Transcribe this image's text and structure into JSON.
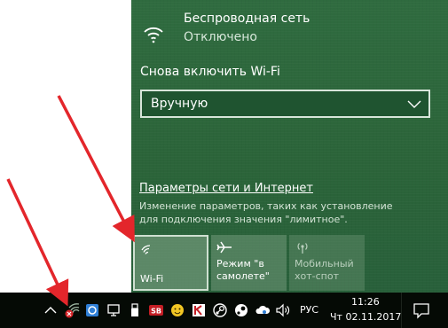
{
  "network": {
    "name": "Беспроводная сеть",
    "status": "Отключено",
    "icon": "wifi-disabled-icon"
  },
  "reenable": {
    "label": "Снова включить Wi-Fi",
    "selected": "Вручную"
  },
  "settings": {
    "link": "Параметры сети и Интернет",
    "description": "Изменение параметров, таких как установление для подключения значения \"лимитное\"."
  },
  "tiles": {
    "wifi": {
      "label": "Wi-Fi",
      "icon": "wifi-icon"
    },
    "airplane": {
      "label_line1": "Режим \"в",
      "label_line2": "самолете\"",
      "icon": "airplane-icon"
    },
    "hotspot": {
      "label_line1": "Мобильный",
      "label_line2": "хот-спот",
      "icon": "hotspot-icon"
    }
  },
  "taskbar": {
    "language": "РУС",
    "time": "11:26",
    "date": "Чт 02.11.2017",
    "icons": [
      "chevron-up-icon",
      "network-error-icon",
      "display-icon",
      "usb-icon",
      "sb-icon",
      "emoji-icon",
      "k-icon",
      "steam-icon",
      "cloud-icon",
      "volume-icon",
      "notification-icon"
    ]
  },
  "colors": {
    "flyout_bg": "#2b6439",
    "taskbar_bg": "#050a05",
    "arrow": "#e3262b"
  }
}
